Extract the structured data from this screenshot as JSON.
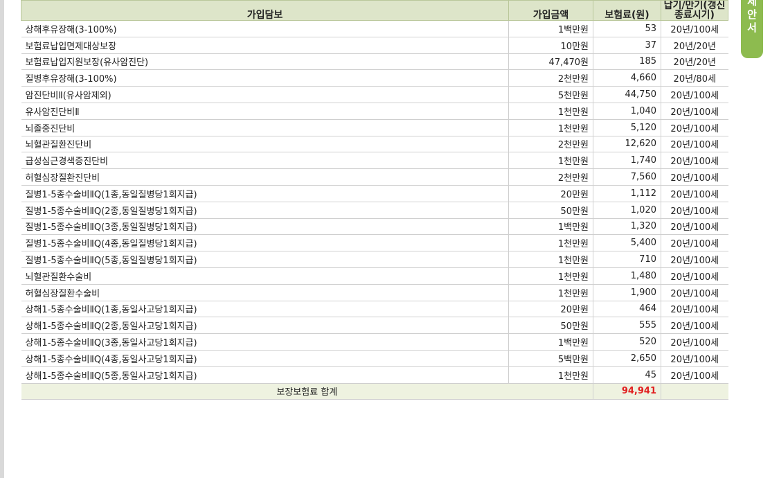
{
  "table": {
    "headers": [
      "가입담보",
      "가입금액",
      "보험료(원)",
      "납기/만기(갱신종료시기)"
    ],
    "rows": [
      [
        "상해후유장해(3-100%)",
        "1백만원",
        "53",
        "20년/100세"
      ],
      [
        "보험료납입면제대상보장",
        "10만원",
        "37",
        "20년/20년"
      ],
      [
        "보험료납입지원보장(유사암진단)",
        "47,470원",
        "185",
        "20년/20년"
      ],
      [
        "질병후유장해(3-100%)",
        "2천만원",
        "4,660",
        "20년/80세"
      ],
      [
        "암진단비Ⅱ(유사암제외)",
        "5천만원",
        "44,750",
        "20년/100세"
      ],
      [
        "유사암진단비Ⅱ",
        "1천만원",
        "1,040",
        "20년/100세"
      ],
      [
        "뇌졸중진단비",
        "1천만원",
        "5,120",
        "20년/100세"
      ],
      [
        "뇌혈관질환진단비",
        "2천만원",
        "12,620",
        "20년/100세"
      ],
      [
        "급성심근경색증진단비",
        "1천만원",
        "1,740",
        "20년/100세"
      ],
      [
        "허혈심장질환진단비",
        "2천만원",
        "7,560",
        "20년/100세"
      ],
      [
        "질병1-5종수술비ⅡQ(1종,동일질병당1회지급)",
        "20만원",
        "1,112",
        "20년/100세"
      ],
      [
        "질병1-5종수술비ⅡQ(2종,동일질병당1회지급)",
        "50만원",
        "1,020",
        "20년/100세"
      ],
      [
        "질병1-5종수술비ⅡQ(3종,동일질병당1회지급)",
        "1백만원",
        "1,320",
        "20년/100세"
      ],
      [
        "질병1-5종수술비ⅡQ(4종,동일질병당1회지급)",
        "1천만원",
        "5,400",
        "20년/100세"
      ],
      [
        "질병1-5종수술비ⅡQ(5종,동일질병당1회지급)",
        "1천만원",
        "710",
        "20년/100세"
      ],
      [
        "뇌혈관질환수술비",
        "1천만원",
        "1,480",
        "20년/100세"
      ],
      [
        "허혈심장질환수술비",
        "1천만원",
        "1,900",
        "20년/100세"
      ],
      [
        "상해1-5종수술비ⅡQ(1종,동일사고당1회지급)",
        "20만원",
        "464",
        "20년/100세"
      ],
      [
        "상해1-5종수술비ⅡQ(2종,동일사고당1회지급)",
        "50만원",
        "555",
        "20년/100세"
      ],
      [
        "상해1-5종수술비ⅡQ(3종,동일사고당1회지급)",
        "1백만원",
        "520",
        "20년/100세"
      ],
      [
        "상해1-5종수술비ⅡQ(4종,동일사고당1회지급)",
        "5백만원",
        "2,650",
        "20년/100세"
      ],
      [
        "상해1-5종수술비ⅡQ(5종,동일사고당1회지급)",
        "1천만원",
        "45",
        "20년/100세"
      ]
    ],
    "total_label": "보장보험료 합계",
    "total_value": "94,941"
  },
  "side_tab": {
    "chars": [
      "제",
      "안",
      "서"
    ],
    "color": "#8dbb4f"
  },
  "colors": {
    "header_bg": "#dde5c9",
    "total_bg": "#eef2e0",
    "total_value": "#e11f1f"
  }
}
